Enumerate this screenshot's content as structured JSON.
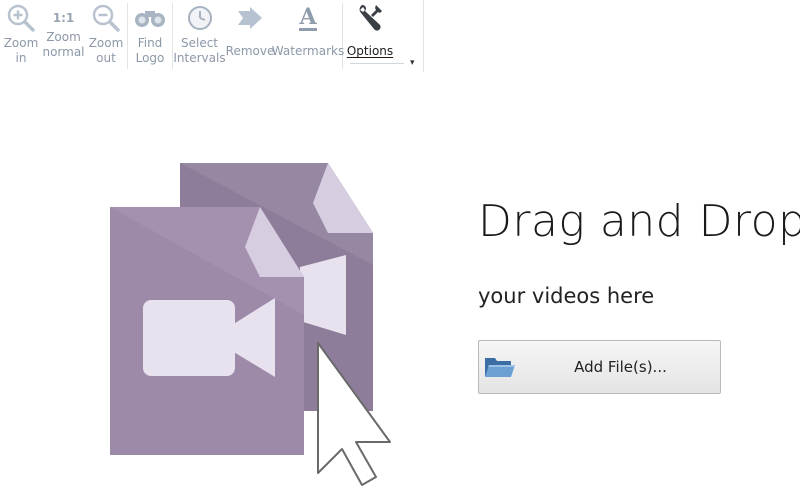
{
  "ribbon": {
    "tools": [
      {
        "id": "zoom-in",
        "label": "Zoom\nin",
        "icon": "zoom-in-icon",
        "state": "disabled"
      },
      {
        "id": "zoom-normal",
        "label": "Zoom\nnormal",
        "icon": "one-to-one-icon",
        "icon_text": "1:1",
        "state": "disabled"
      },
      {
        "id": "zoom-out",
        "label": "Zoom\nout",
        "icon": "zoom-out-icon",
        "state": "disabled"
      },
      {
        "id": "find-logo",
        "label": "Find\nLogo",
        "icon": "binoculars-icon",
        "state": "disabled"
      },
      {
        "id": "select-intervals",
        "label": "Select\nIntervals",
        "icon": "clock-icon",
        "state": "disabled"
      },
      {
        "id": "remove",
        "label": "Remove",
        "icon": "arrow-right-icon",
        "state": "disabled"
      },
      {
        "id": "watermarks",
        "label": "Watermarks",
        "icon": "letter-a-icon",
        "icon_text": "A",
        "state": "disabled"
      },
      {
        "id": "options",
        "label": "Options",
        "icon": "wrench-icon",
        "state": "enabled"
      }
    ],
    "dropdown_glyph": "▾"
  },
  "main": {
    "title": "Drag and Drop",
    "subtitle": "your videos here",
    "add_button_label": "Add File(s)..."
  },
  "colors": {
    "file_front": "#9c8aa8",
    "file_back": "#8d7d9a",
    "file_fold": "#d6cde0",
    "camera": "#e7e2ed",
    "disabled_text": "#7e8fa3",
    "folder_blue": "#3a6ea5"
  }
}
